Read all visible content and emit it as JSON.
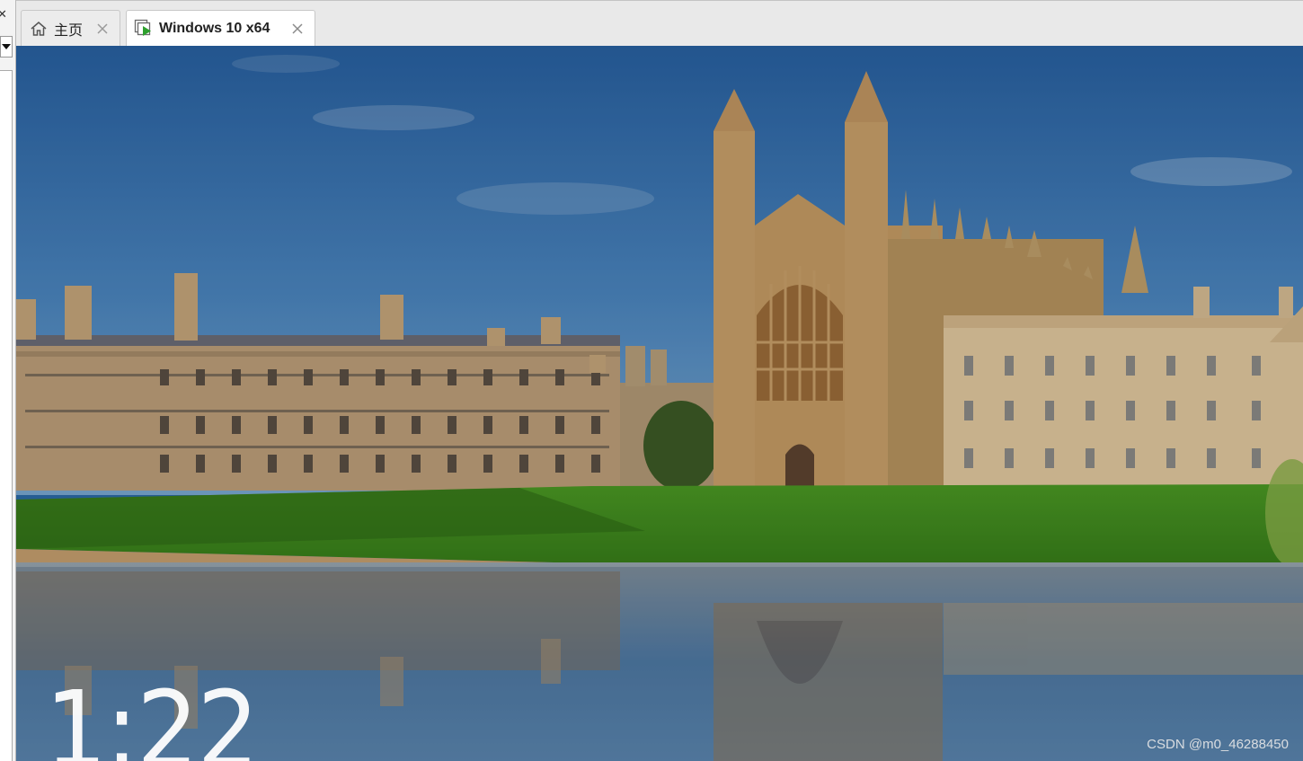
{
  "tabs": [
    {
      "label": "主页",
      "icon": "home-icon",
      "close_icon": "close-icon"
    },
    {
      "label": "Windows 10 x64",
      "icon": "vm-play-icon",
      "close_icon": "close-icon",
      "active": true
    }
  ],
  "lock_screen": {
    "time": "1:22"
  },
  "watermark": "CSDN @m0_46288450",
  "colors": {
    "tab_bar": "#e9e9e9",
    "active_tab": "#ffffff",
    "sky": "#2c6aa8",
    "lawn": "#3f8a1e",
    "stone": "#d9b98a"
  }
}
